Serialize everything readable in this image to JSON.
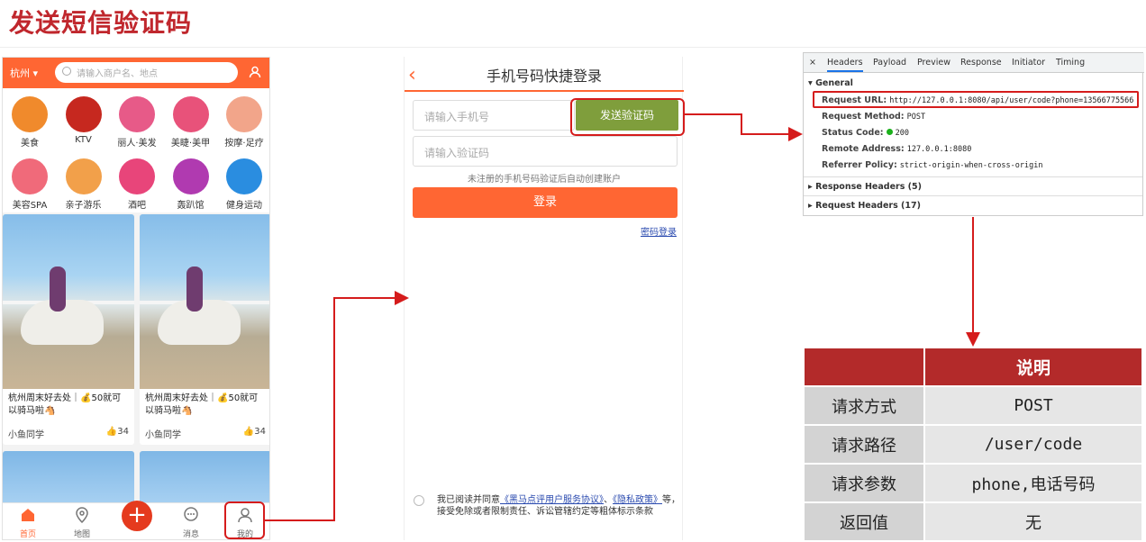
{
  "slide_title": "发送短信验证码",
  "phone1": {
    "city": "杭州",
    "search_placeholder": "请输入商户名、地点",
    "categories": [
      "美食",
      "KTV",
      "丽人·美发",
      "美睫·美甲",
      "按摩·足疗",
      "美容SPA",
      "亲子游乐",
      "酒吧",
      "轰趴馆",
      "健身运动"
    ],
    "category_colors": [
      "#f08a2c",
      "#c6281f",
      "#e75a88",
      "#e8527a",
      "#f2a58a",
      "#f06a7a",
      "#f2a04a",
      "#e8457a",
      "#b03ab0",
      "#2a8de0"
    ],
    "cards": [
      {
        "text": "杭州周末好去处｜💰50就可以骑马啦🐴",
        "author": "小鱼同学",
        "likes": "34"
      },
      {
        "text": "杭州周末好去处｜💰50就可以骑马啦🐴",
        "author": "小鱼同学",
        "likes": "34"
      }
    ],
    "tabs": [
      "首页",
      "地图",
      "",
      "消息",
      "我的"
    ],
    "add_symbol": "+"
  },
  "phone2": {
    "back_symbol": "‹",
    "title": "手机号码快捷登录",
    "phone_placeholder": "请输入手机号",
    "send_code_label": "发送验证码",
    "code_placeholder": "请输入验证码",
    "hint": "未注册的手机号码验证后自动创建账户",
    "login_label": "登录",
    "password_login_label": "密码登录",
    "agree_prefix": "我已阅读并同意",
    "agree_link1": "《黑马点评用户服务协议》",
    "agree_sep": "、",
    "agree_link2": "《隐私政策》",
    "agree_suffix": "等，接受免除或者限制责任、诉讼管辖约定等粗体标示条款"
  },
  "devtools": {
    "close_symbol": "×",
    "tabs": [
      "Headers",
      "Payload",
      "Preview",
      "Response",
      "Initiator",
      "Timing"
    ],
    "general_label": "General",
    "rows": [
      {
        "key": "Request URL:",
        "value": "http://127.0.0.1:8080/api/user/code?phone=13566775566"
      },
      {
        "key": "Request Method:",
        "value": "POST"
      },
      {
        "key": "Status Code:",
        "value": "200"
      },
      {
        "key": "Remote Address:",
        "value": "127.0.0.1:8080"
      },
      {
        "key": "Referrer Policy:",
        "value": "strict-origin-when-cross-origin"
      }
    ],
    "response_headers_label": "Response Headers (5)",
    "request_headers_label": "Request Headers (17)"
  },
  "table": {
    "header": [
      "",
      "说明"
    ],
    "rows": [
      [
        "请求方式",
        "POST"
      ],
      [
        "请求路径",
        "/user/code"
      ],
      [
        "请求参数",
        "phone,电话号码"
      ],
      [
        "返回值",
        "无"
      ]
    ]
  },
  "colors": {
    "accent": "#ff6633",
    "highlight": "#d51c1c",
    "title": "#c0272d",
    "table_header": "#b32a2a",
    "send_button": "#7f9e3c"
  }
}
